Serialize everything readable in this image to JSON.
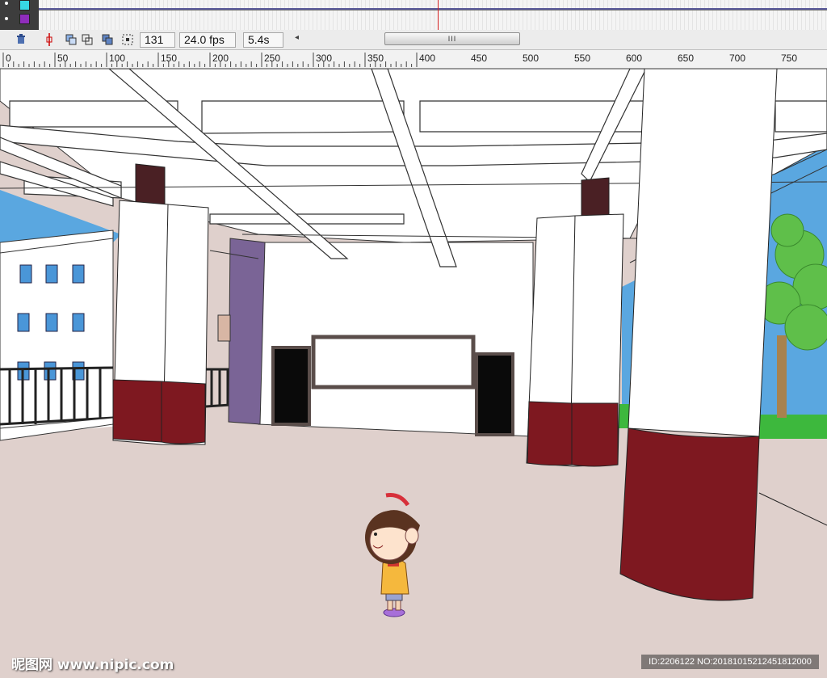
{
  "timeline": {
    "layers": [
      {
        "swatch_color": "#37d7e3"
      },
      {
        "swatch_color": "#8f2dbb"
      }
    ],
    "trash_icon": "trash-icon",
    "frame_number": "131",
    "frame_rate": "24.0 fps",
    "elapsed_time": "5.4s",
    "scroll_left_arrow": "◂",
    "scroll_thumb_grip": "III"
  },
  "ruler": {
    "labels": [
      "0",
      "50",
      "100",
      "150",
      "200",
      "250",
      "300",
      "350",
      "400",
      "450",
      "500",
      "550",
      "600",
      "650",
      "700",
      "750"
    ]
  },
  "colors": {
    "floor": "#dfd0cc",
    "pillar_base": "#7e1820",
    "pillar_cap": "#4a2024",
    "side_wall": "#7a6496",
    "sky": "#5aa7e0",
    "grass": "#3db83d",
    "door": "#0a0a0a"
  },
  "watermark": {
    "site": "昵图网 www.nipic.com",
    "id": "ID:2206122 NO:20181015212451812000"
  }
}
